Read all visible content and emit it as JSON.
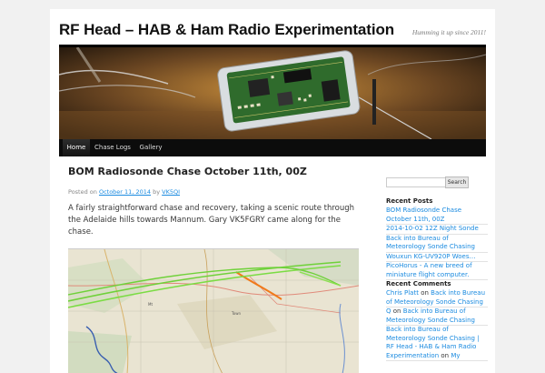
{
  "site": {
    "title": "RF Head – HAB & Ham Radio Experimentation",
    "description": "Humming it up since 2011!"
  },
  "nav": {
    "items": [
      {
        "label": "Home"
      },
      {
        "label": "Chase Logs"
      },
      {
        "label": "Gallery"
      }
    ]
  },
  "post": {
    "title": "BOM Radiosonde Chase October 11th, 00Z",
    "meta_posted_on": "Posted on",
    "meta_date": "October 11, 2014",
    "meta_by": "by",
    "meta_author": "VK5QI",
    "body": "A fairly straightforward chase and recovery, taking a scenic route through the Adelaide hills towards Mannum. Gary VK5FGRY came along for the chase."
  },
  "sidebar": {
    "search_button": "Search",
    "recent_posts_title": "Recent Posts",
    "recent_posts": [
      "BOM Radiosonde Chase October 11th, 00Z",
      "2014-10-02 12Z Night Sonde",
      "Back into Bureau of Meteorology Sonde Chasing",
      "Wouxun KG-UV920P Woes…",
      "PicoHorus - A new breed of miniature flight computer."
    ],
    "recent_comments_title": "Recent Comments",
    "recent_comments": [
      {
        "author": "Chris Platt",
        "on": "on",
        "post": "Back into Bureau of Meteorology Sonde Chasing"
      },
      {
        "author": "Q",
        "on": "on",
        "post": "Back into Bureau of Meteorology Sonde Chasing"
      },
      {
        "author": "Back into Bureau of Meteorology Sonde Chasing | RF Head - HAB & Ham Radio Experimentation",
        "on": "on",
        "post": "My"
      }
    ]
  },
  "colors": {
    "link": "#1b8be0",
    "nav_bg": "#0c0c0c",
    "track": "#6fd13a"
  }
}
